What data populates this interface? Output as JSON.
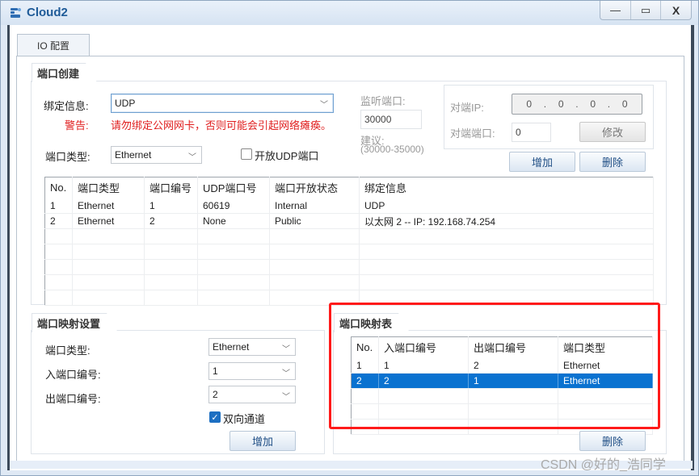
{
  "window": {
    "title": "Cloud2",
    "minimize_label": "—",
    "maximize_label": "▭",
    "close_label": "X"
  },
  "tabs": [
    {
      "label": "IO 配置",
      "active": true
    }
  ],
  "port_creation": {
    "group_title": "端口创建",
    "bind_label": "绑定信息:",
    "bind_value": "UDP",
    "warning_label": "警告:",
    "warning_text": "请勿绑定公网网卡，否则可能会引起网络瘫痪。",
    "port_type_label": "端口类型:",
    "port_type_value": "Ethernet",
    "open_udp_label": "开放UDP端口",
    "open_udp_checked": false,
    "listen_port_label": "监听端口:",
    "listen_port_value": "30000",
    "suggest_label": "建议:",
    "suggest_range": "(30000-35000)",
    "peer_ip_label": "对端IP:",
    "peer_ip_octets": [
      "0",
      "0",
      "0",
      "0"
    ],
    "peer_port_label": "对端端口:",
    "peer_port_value": "0",
    "modify_button": "修改",
    "add_button": "增加",
    "delete_button": "删除",
    "table": {
      "headers": [
        "No.",
        "端口类型",
        "端口编号",
        "UDP端口号",
        "端口开放状态",
        "绑定信息"
      ],
      "rows": [
        [
          "1",
          "Ethernet",
          "1",
          "60619",
          "Internal",
          "UDP"
        ],
        [
          "2",
          "Ethernet",
          "2",
          "None",
          "Public",
          "以太网 2 -- IP: 192.168.74.254"
        ]
      ]
    }
  },
  "port_mapping_settings": {
    "group_title": "端口映射设置",
    "port_type_label": "端口类型:",
    "port_type_value": "Ethernet",
    "in_port_label": "入端口编号:",
    "in_port_value": "1",
    "out_port_label": "出端口编号:",
    "out_port_value": "2",
    "bidirectional_label": "双向通道",
    "bidirectional_checked": true,
    "add_button": "增加"
  },
  "port_mapping_table": {
    "group_title": "端口映射表",
    "headers": [
      "No.",
      "入端口编号",
      "出端口编号",
      "端口类型"
    ],
    "rows": [
      [
        "1",
        "1",
        "2",
        "Ethernet"
      ],
      [
        "2",
        "2",
        "1",
        "Ethernet"
      ]
    ],
    "selected_row": 2,
    "delete_button": "删除"
  },
  "watermark": "CSDN @好的_浩同学",
  "colors": {
    "title_text": "#1f5b98",
    "warning_red": "#e02020",
    "selection_blue": "#0a72d0",
    "highlight_red": "#ff1a1a"
  }
}
